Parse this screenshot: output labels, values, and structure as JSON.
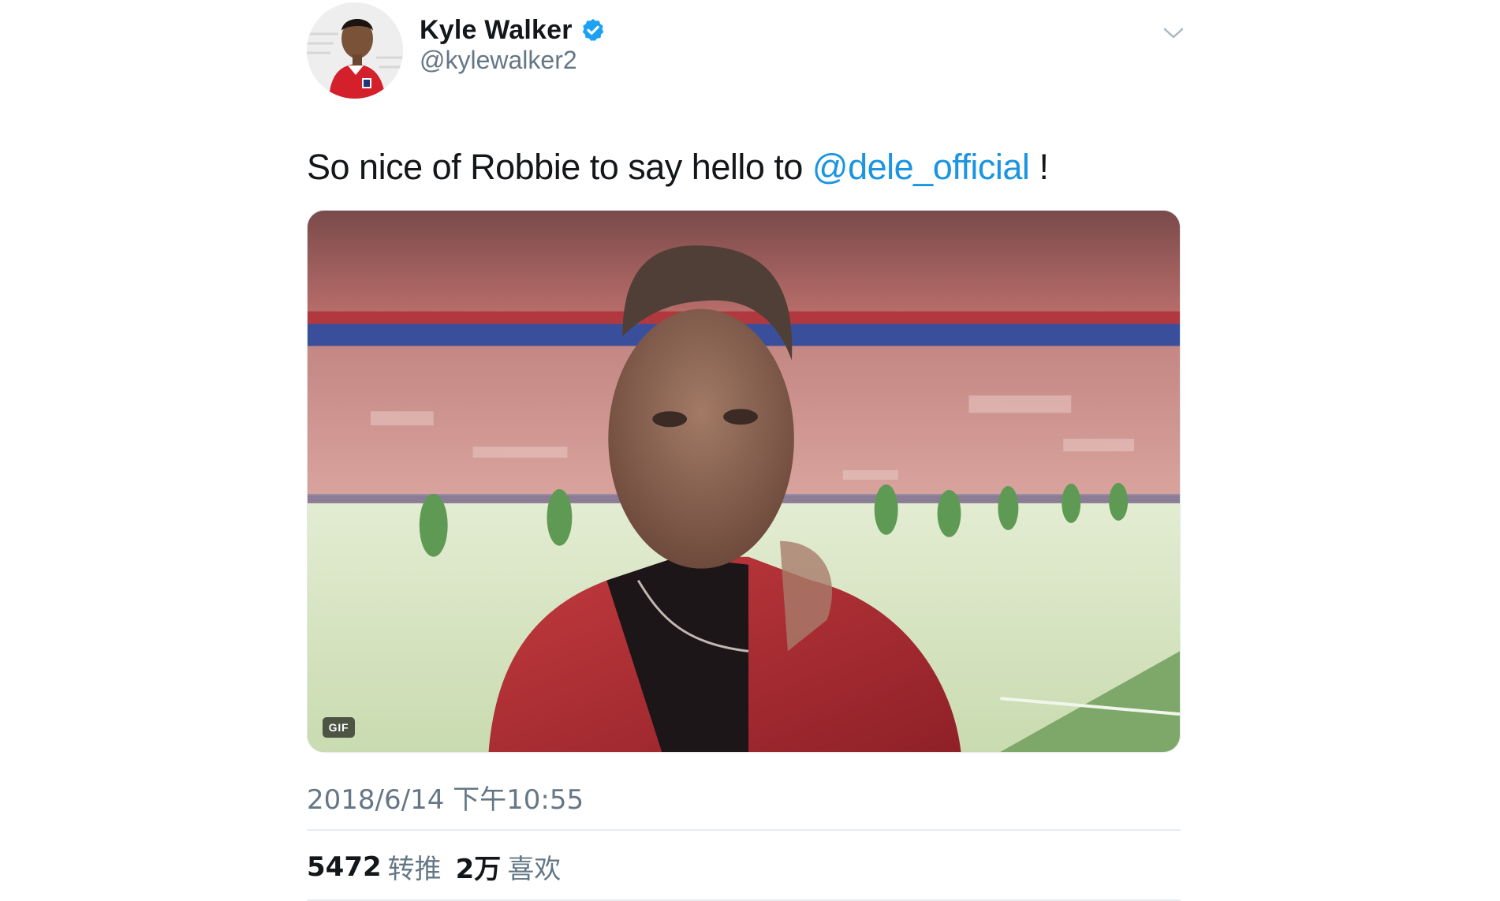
{
  "author": {
    "display_name": "Kyle Walker",
    "handle": "@kylewalker2",
    "verified": true,
    "avatar_icon": "profile-photo"
  },
  "tweet": {
    "text_before": "So nice of Robbie to say hello to ",
    "mention": "@dele_official",
    "text_after": " !",
    "media": {
      "type": "gif",
      "badge": "GIF"
    },
    "timestamp": "2018/6/14 下午10:55"
  },
  "stats": {
    "retweets_count": "5472",
    "retweets_label": "转推",
    "likes_count": "2万",
    "likes_label": "喜欢"
  },
  "colors": {
    "mention": "#1b95e0",
    "secondary_text": "#657786",
    "verified": "#1da1f2"
  }
}
